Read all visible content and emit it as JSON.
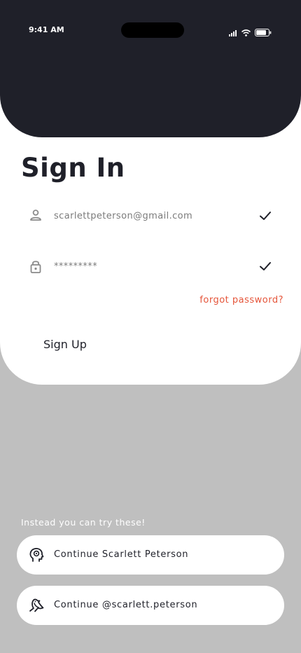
{
  "status_bar": {
    "time": "9:41 AM",
    "icons": [
      "signal-icon",
      "wifi-icon",
      "battery-icon"
    ]
  },
  "form": {
    "title": "Sign In",
    "email": {
      "value": "scarlettpeterson@gmail.com",
      "icon": "user-icon",
      "valid_icon": "check-icon"
    },
    "password": {
      "value": "*********",
      "icon": "lock-icon",
      "valid_icon": "check-icon"
    },
    "forgot_label": "forgot password?",
    "signup_label": "Sign Up"
  },
  "alternatives": {
    "heading": "Instead you can try these!",
    "options": [
      {
        "label": "Continue Scarlett Peterson",
        "icon": "head-icon"
      },
      {
        "label": "Continue @scarlett.peterson",
        "icon": "bird-icon"
      }
    ]
  },
  "colors": {
    "header_bg": "#1f2029",
    "page_bg": "#bfbfbf",
    "accent": "#e5553a",
    "card_bg": "#ffffff"
  }
}
